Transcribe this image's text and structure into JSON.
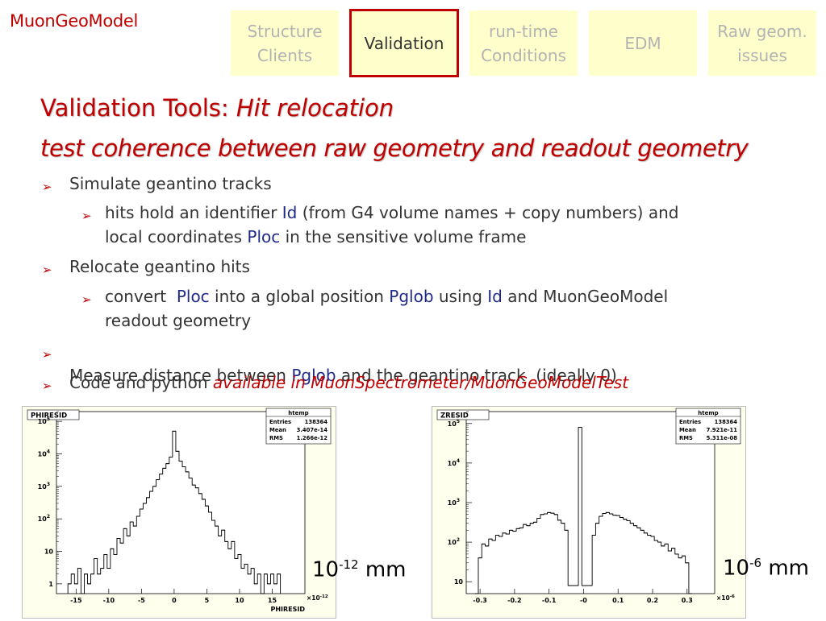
{
  "brand": "MuonGeoModel",
  "tabs": [
    {
      "label": "Structure\nClients",
      "active": false
    },
    {
      "label": "Validation",
      "active": true
    },
    {
      "label": "run-time\nConditions",
      "active": false
    },
    {
      "label": "EDM",
      "active": false
    },
    {
      "label": "Raw geom.\nissues",
      "active": false
    }
  ],
  "title": {
    "prefix": "Validation Tools: ",
    "emph": "Hit relocation"
  },
  "subtitle": "test coherence between raw geometry and readout geometry",
  "bullets": {
    "b1": "Simulate geantino tracks",
    "b1a_1": "hits hold an identifier ",
    "b1a_kw1": "Id",
    "b1a_2": " (from G4 volume names + copy numbers) and",
    "b1a_3": "local coordinates ",
    "b1a_kw2": "Ploc",
    "b1a_4": " in the sensitive volume frame",
    "b2": "Relocate geantino hits",
    "b2a_1": "convert  ",
    "b2a_kw1": "Ploc",
    "b2a_2": " into a global position ",
    "b2a_kw2": "Pglob",
    "b2a_3": " using ",
    "b2a_kw3": "Id",
    "b2a_4": " and MuonGeoModel",
    "b2a_5": "readout geometry",
    "b3_1": "Measure distance between ",
    "b3_kw": "Pglob",
    "b3_2": " and the geantino track  (ideally 0)",
    "b4_1": "Code and python ",
    "b4_em": "available in MuonSpectrometer/MuonGeoModelTest"
  },
  "units": [
    {
      "base": "10",
      "exp": "-12",
      "suffix": " mm"
    },
    {
      "base": "10",
      "exp": "-6",
      "suffix": " mm"
    }
  ],
  "chart_data": [
    {
      "type": "histogram",
      "title": "PHIRESID",
      "xlabel": "PHIRESID",
      "x_multiplier": "×10",
      "x_multiplier_exp": "-12",
      "xlim": [
        -18,
        20
      ],
      "yscale": "log",
      "ylim": [
        0.5,
        200000
      ],
      "xticks": [
        -15,
        -10,
        -5,
        0,
        5,
        10,
        15
      ],
      "yticks": [
        {
          "v": 1,
          "label": "1"
        },
        {
          "v": 10,
          "label": "10"
        },
        {
          "v": 100,
          "label": "10",
          "exp": "2"
        },
        {
          "v": 1000,
          "label": "10",
          "exp": "3"
        },
        {
          "v": 10000,
          "label": "10",
          "exp": "4"
        },
        {
          "v": 100000,
          "label": "10",
          "exp": "5"
        }
      ],
      "stats": {
        "name": "htemp",
        "rows": [
          [
            "Entries",
            "138364"
          ],
          [
            "Mean",
            "3.407e-14"
          ],
          [
            "RMS",
            "1.266e-12"
          ]
        ]
      },
      "bin_width": 0.5,
      "bins": [
        [
          -16.0,
          1
        ],
        [
          -15.5,
          2
        ],
        [
          -15.0,
          1
        ],
        [
          -14.5,
          3
        ],
        [
          -14.0,
          0
        ],
        [
          -13.5,
          2
        ],
        [
          -13.0,
          1
        ],
        [
          -12.5,
          2
        ],
        [
          -12.0,
          6
        ],
        [
          -11.5,
          2
        ],
        [
          -11.0,
          3
        ],
        [
          -10.5,
          8
        ],
        [
          -10.0,
          3
        ],
        [
          -9.5,
          12
        ],
        [
          -9.0,
          8
        ],
        [
          -8.5,
          25
        ],
        [
          -8.0,
          18
        ],
        [
          -7.5,
          50
        ],
        [
          -7.0,
          30
        ],
        [
          -6.5,
          80
        ],
        [
          -6.0,
          60
        ],
        [
          -5.5,
          120
        ],
        [
          -5.0,
          200
        ],
        [
          -4.5,
          300
        ],
        [
          -4.0,
          450
        ],
        [
          -3.5,
          700
        ],
        [
          -3.0,
          1000
        ],
        [
          -2.5,
          1600
        ],
        [
          -2.0,
          2400
        ],
        [
          -1.5,
          3600
        ],
        [
          -1.0,
          5000
        ],
        [
          -0.5,
          8000
        ],
        [
          0.0,
          50000
        ],
        [
          0.5,
          12000
        ],
        [
          1.0,
          6000
        ],
        [
          1.5,
          4000
        ],
        [
          2.0,
          2800
        ],
        [
          2.5,
          1800
        ],
        [
          3.0,
          1100
        ],
        [
          3.5,
          900
        ],
        [
          4.0,
          600
        ],
        [
          4.5,
          400
        ],
        [
          5.0,
          250
        ],
        [
          5.5,
          160
        ],
        [
          6.0,
          90
        ],
        [
          6.5,
          60
        ],
        [
          7.0,
          30
        ],
        [
          7.5,
          45
        ],
        [
          8.0,
          20
        ],
        [
          8.5,
          12
        ],
        [
          9.0,
          20
        ],
        [
          9.5,
          6
        ],
        [
          10.0,
          8
        ],
        [
          10.5,
          3
        ],
        [
          11.0,
          4
        ],
        [
          11.5,
          2
        ],
        [
          12.0,
          3
        ],
        [
          12.5,
          1
        ],
        [
          13.0,
          2
        ],
        [
          13.5,
          0
        ],
        [
          14.0,
          2
        ],
        [
          14.5,
          1
        ],
        [
          15.0,
          2
        ],
        [
          15.5,
          1
        ],
        [
          16.0,
          2
        ]
      ]
    },
    {
      "type": "histogram",
      "title": "ZRESID",
      "xlabel": "",
      "x_multiplier": "×10",
      "x_multiplier_exp": "-6",
      "xlim": [
        -0.34,
        0.38
      ],
      "yscale": "log",
      "ylim": [
        5,
        200000
      ],
      "xticks": [
        -0.3,
        -0.2,
        -0.1,
        0,
        0.1,
        0.2,
        0.3
      ],
      "xticklabels": [
        "-0.3",
        "-0.2",
        "-0.1",
        "-0",
        "0.1",
        "0.2",
        "0.3"
      ],
      "yticks": [
        {
          "v": 10,
          "label": "10"
        },
        {
          "v": 100,
          "label": "10",
          "exp": "2"
        },
        {
          "v": 1000,
          "label": "10",
          "exp": "3"
        },
        {
          "v": 10000,
          "label": "10",
          "exp": "4"
        },
        {
          "v": 100000,
          "label": "10",
          "exp": "5"
        }
      ],
      "stats": {
        "name": "htemp",
        "rows": [
          [
            "Entries",
            "138364"
          ],
          [
            "Mean",
            "7.921e-11"
          ],
          [
            "RMS",
            "5.311e-08"
          ]
        ]
      },
      "bin_width": 0.01,
      "bins": [
        [
          -0.31,
          0
        ],
        [
          -0.3,
          40
        ],
        [
          -0.29,
          90
        ],
        [
          -0.28,
          80
        ],
        [
          -0.27,
          120
        ],
        [
          -0.26,
          110
        ],
        [
          -0.25,
          150
        ],
        [
          -0.24,
          140
        ],
        [
          -0.23,
          170
        ],
        [
          -0.22,
          160
        ],
        [
          -0.21,
          200
        ],
        [
          -0.2,
          190
        ],
        [
          -0.19,
          220
        ],
        [
          -0.18,
          230
        ],
        [
          -0.17,
          280
        ],
        [
          -0.16,
          260
        ],
        [
          -0.15,
          300
        ],
        [
          -0.14,
          320
        ],
        [
          -0.13,
          400
        ],
        [
          -0.12,
          500
        ],
        [
          -0.11,
          520
        ],
        [
          -0.1,
          560
        ],
        [
          -0.09,
          540
        ],
        [
          -0.08,
          500
        ],
        [
          -0.07,
          360
        ],
        [
          -0.06,
          300
        ],
        [
          -0.05,
          200
        ],
        [
          -0.04,
          8
        ],
        [
          -0.03,
          8
        ],
        [
          -0.02,
          8
        ],
        [
          -0.01,
          80000
        ],
        [
          0.0,
          8
        ],
        [
          0.01,
          8
        ],
        [
          0.02,
          8
        ],
        [
          0.03,
          150
        ],
        [
          0.04,
          300
        ],
        [
          0.05,
          450
        ],
        [
          0.06,
          530
        ],
        [
          0.07,
          560
        ],
        [
          0.08,
          520
        ],
        [
          0.09,
          480
        ],
        [
          0.1,
          470
        ],
        [
          0.11,
          420
        ],
        [
          0.12,
          380
        ],
        [
          0.13,
          350
        ],
        [
          0.14,
          300
        ],
        [
          0.15,
          260
        ],
        [
          0.16,
          230
        ],
        [
          0.17,
          200
        ],
        [
          0.18,
          170
        ],
        [
          0.19,
          150
        ],
        [
          0.2,
          140
        ],
        [
          0.21,
          110
        ],
        [
          0.22,
          100
        ],
        [
          0.23,
          80
        ],
        [
          0.24,
          90
        ],
        [
          0.25,
          60
        ],
        [
          0.26,
          70
        ],
        [
          0.27,
          50
        ],
        [
          0.28,
          40
        ],
        [
          0.29,
          45
        ],
        [
          0.3,
          30
        ],
        [
          0.31,
          0
        ]
      ]
    }
  ]
}
